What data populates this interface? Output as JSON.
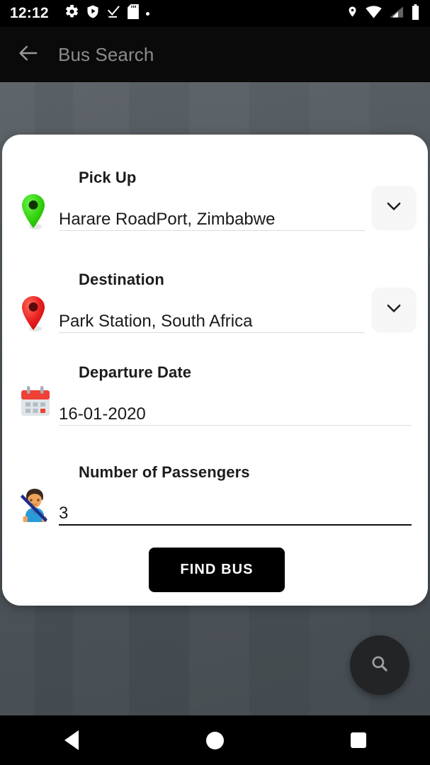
{
  "status_bar": {
    "time": "12:12",
    "left_icons": [
      "gear-icon",
      "shield-play-icon",
      "check-download-icon",
      "sd-card-icon",
      "dot-icon"
    ],
    "right_icons": [
      "location-pin-icon",
      "wifi-icon",
      "cellular-signal-icon",
      "battery-icon"
    ]
  },
  "app_bar": {
    "back_icon": "back-arrow-icon",
    "title": "Bus Search",
    "title_color": "#8b8b8b",
    "background_color": "#0a0a0a"
  },
  "form": {
    "pickup": {
      "label": "Pick Up",
      "value": "Harare RoadPort, Zimbabwe",
      "icon": "green-map-pin-icon",
      "icon_color": "#35d911",
      "dropdown_icon": "chevron-down-icon"
    },
    "destination": {
      "label": "Destination",
      "value": "Park Station, South Africa",
      "icon": "red-map-pin-icon",
      "icon_color": "#e8201e",
      "dropdown_icon": "chevron-down-icon"
    },
    "departure_date": {
      "label": "Departure Date",
      "value": "16-01-2020",
      "icon": "calendar-icon"
    },
    "passengers": {
      "label": "Number of Passengers",
      "value": "3",
      "icon": "passenger-person-icon"
    },
    "submit_label": "FIND BUS",
    "submit_color": "#000000"
  },
  "fab": {
    "icon": "search-icon",
    "background_color": "#232426"
  },
  "nav_bar": {
    "back_icon": "nav-back-triangle-icon",
    "home_icon": "nav-home-circle-icon",
    "recents_icon": "nav-recents-square-icon"
  },
  "theme": {
    "background_color": "#4f575c",
    "card_color": "#ffffff",
    "accent_color": "#000000"
  }
}
